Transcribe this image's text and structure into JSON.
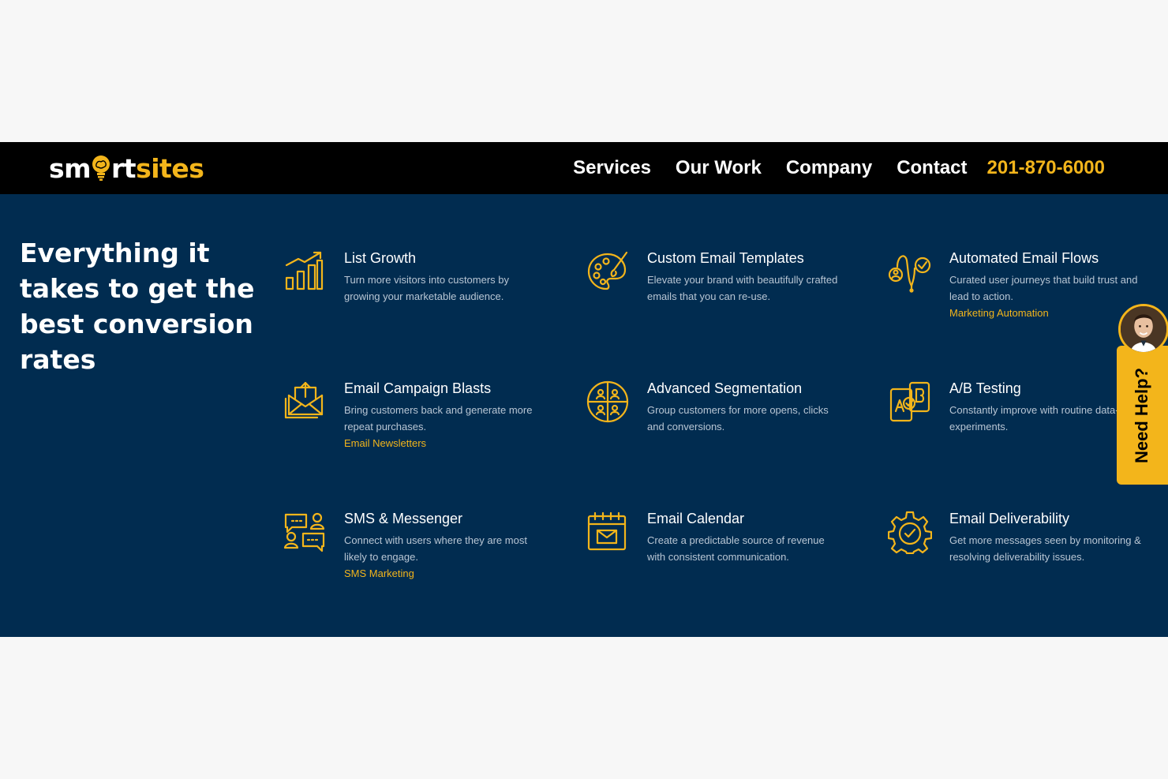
{
  "brand": {
    "logo_part1": "sm",
    "logo_part2": "rt",
    "logo_part3": "sites",
    "accent_color": "#f3b51b",
    "nav_bg": "#000000",
    "section_bg": "#012c50"
  },
  "nav": {
    "items": [
      {
        "label": "Services"
      },
      {
        "label": "Our Work"
      },
      {
        "label": "Company"
      },
      {
        "label": "Contact"
      }
    ],
    "phone": "201-870-6000"
  },
  "section": {
    "headline": "Everything it takes to get the best conversion rates",
    "features": [
      {
        "icon": "bar-chart-growth-icon",
        "title": "List Growth",
        "desc": "Turn more visitors into customers by growing your marketable audience.",
        "link": ""
      },
      {
        "icon": "palette-brush-icon",
        "title": "Custom Email Templates",
        "desc": "Elevate your brand with beautifully crafted emails that you can re-use.",
        "link": ""
      },
      {
        "icon": "flow-users-icon",
        "title": "Automated Email Flows",
        "desc": "Curated user journeys that build trust and lead to action.",
        "link": "Marketing Automation"
      },
      {
        "icon": "email-stack-icon",
        "title": "Email Campaign Blasts",
        "desc": "Bring customers back and generate more repeat purchases.",
        "link": "Email Newsletters"
      },
      {
        "icon": "segmentation-pie-icon",
        "title": "Advanced Segmentation",
        "desc": "Group customers for more opens, clicks and conversions.",
        "link": ""
      },
      {
        "icon": "ab-test-icon",
        "title": "A/B Testing",
        "desc": "Constantly improve with routine data-driven experiments.",
        "link": ""
      },
      {
        "icon": "chat-users-icon",
        "title": "SMS & Messenger",
        "desc": "Connect with users where they are most likely to engage.",
        "link": "SMS Marketing"
      },
      {
        "icon": "calendar-email-icon",
        "title": "Email Calendar",
        "desc": "Create a predictable source of revenue with consistent communication.",
        "link": ""
      },
      {
        "icon": "gear-check-icon",
        "title": "Email Deliverability",
        "desc": "Get more messages seen by monitoring & resolving deliverability issues.",
        "link": ""
      }
    ]
  },
  "help_widget": {
    "label": "Need Help?"
  }
}
